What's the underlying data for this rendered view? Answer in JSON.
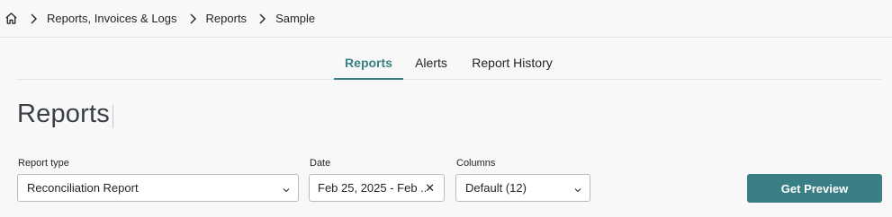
{
  "breadcrumb": {
    "home_icon": "home-icon",
    "items": [
      "Reports, Invoices & Logs",
      "Reports",
      "Sample"
    ]
  },
  "tabs": [
    {
      "label": "Reports",
      "active": true
    },
    {
      "label": "Alerts",
      "active": false
    },
    {
      "label": "Report History",
      "active": false
    }
  ],
  "page": {
    "title": "Reports"
  },
  "filters": {
    "report_type": {
      "label": "Report type",
      "value": "Reconciliation Report"
    },
    "date": {
      "label": "Date",
      "value": "Feb 25, 2025 - Feb ...",
      "clear_glyph": "✕"
    },
    "columns": {
      "label": "Columns",
      "value": "Default (12)"
    }
  },
  "actions": {
    "get_preview": "Get Preview"
  },
  "colors": {
    "accent": "#3b7f86",
    "background": "#f8f8f8",
    "border": "#b9bcbf"
  }
}
